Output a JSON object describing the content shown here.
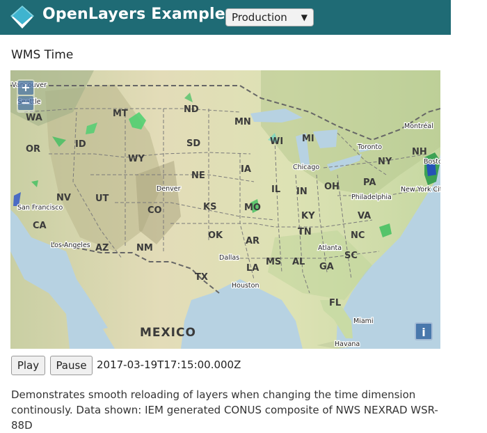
{
  "header": {
    "brand": "OpenLayers Examples",
    "mode_select": "Production"
  },
  "page_title": "WMS Time",
  "map": {
    "zoom_in": "+",
    "zoom_out": "−",
    "info_button": "i",
    "country_label": "MEXICO",
    "states": [
      "WA",
      "OR",
      "CA",
      "ID",
      "NV",
      "MT",
      "WY",
      "UT",
      "AZ",
      "CO",
      "NM",
      "ND",
      "SD",
      "NE",
      "KS",
      "OK",
      "TX",
      "MN",
      "IA",
      "MO",
      "AR",
      "LA",
      "WI",
      "IL",
      "MS",
      "MI",
      "IN",
      "KY",
      "TN",
      "AL",
      "GA",
      "FL",
      "OH",
      "PA",
      "NY",
      "VA",
      "NC",
      "SC",
      "NH"
    ],
    "cities": [
      "Vancouver",
      "Seattle",
      "San Francisco",
      "Los Angeles",
      "Denver",
      "Dallas",
      "Houston",
      "Chicago",
      "Atlanta",
      "Miami",
      "Havana",
      "Toronto",
      "Montréal",
      "Philadelphia",
      "New York City",
      "Boston"
    ]
  },
  "controls": {
    "play_label": "Play",
    "pause_label": "Pause",
    "timestamp": "2017-03-19T17:15:00.000Z"
  },
  "description": "Demonstrates smooth reloading of layers when changing the time dimension continously. Data shown: IEM generated CONUS composite of NWS NEXRAD WSR-88D"
}
